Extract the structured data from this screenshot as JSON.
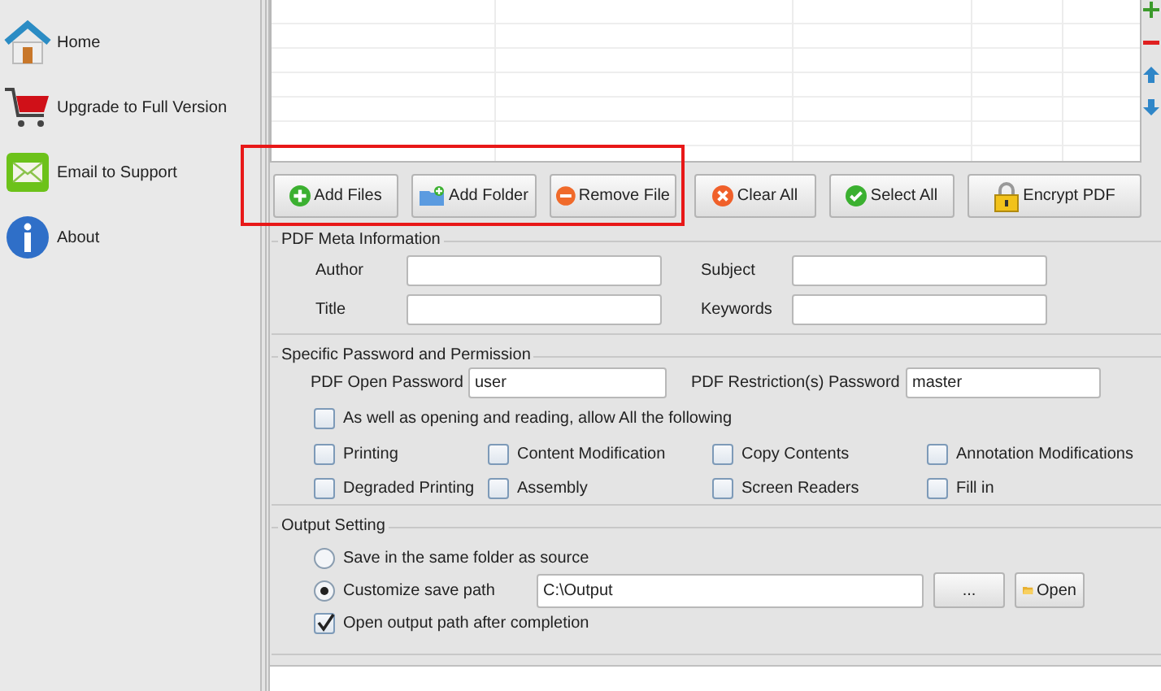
{
  "sidebar": {
    "items": [
      {
        "kind": "home",
        "label": "Home"
      },
      {
        "kind": "cart",
        "label": "Upgrade to Full Version"
      },
      {
        "kind": "mail",
        "label": "Email to Support"
      },
      {
        "kind": "info",
        "label": "About"
      }
    ]
  },
  "buttons": [
    {
      "kind": "add",
      "label": "Add Files"
    },
    {
      "kind": "folder",
      "label": "Add Folder"
    },
    {
      "kind": "remove",
      "label": "Remove File"
    },
    {
      "kind": "clear",
      "label": "Clear All"
    },
    {
      "kind": "check",
      "label": "Select All"
    },
    {
      "kind": "lock",
      "label": "Encrypt PDF"
    }
  ],
  "meta": {
    "title": "PDF Meta Information",
    "fields": [
      {
        "label": "Author"
      },
      {
        "label": "Subject"
      },
      {
        "label": "Title"
      },
      {
        "label": "Keywords"
      }
    ]
  },
  "permission": {
    "title": "Specific Password and Permission",
    "passwords": [
      {
        "label": "PDF Open Password",
        "value": "user"
      },
      {
        "label": "PDF Restriction(s) Password",
        "value": "master"
      }
    ],
    "allow_all": {
      "label": "As well as opening and reading, allow All the following",
      "checked": false
    },
    "permissions": [
      {
        "label": "Printing",
        "checked": false
      },
      {
        "label": "Content Modification",
        "checked": false
      },
      {
        "label": "Copy Contents",
        "checked": false
      },
      {
        "label": "Annotation Modifications",
        "checked": false
      },
      {
        "label": "Degraded Printing",
        "checked": false
      },
      {
        "label": "Assembly",
        "checked": false
      },
      {
        "label": "Screen Readers",
        "checked": false
      },
      {
        "label": "Fill in",
        "checked": false
      }
    ]
  },
  "output": {
    "title": "Output Setting",
    "options": [
      {
        "label": "Save in the same folder as source",
        "selected": false
      },
      {
        "label": "Customize save path",
        "selected": true
      }
    ],
    "path": "C:\\Output",
    "browse": "...",
    "open": "Open",
    "open_after": {
      "label": "Open output path after completion",
      "checked": true
    }
  }
}
